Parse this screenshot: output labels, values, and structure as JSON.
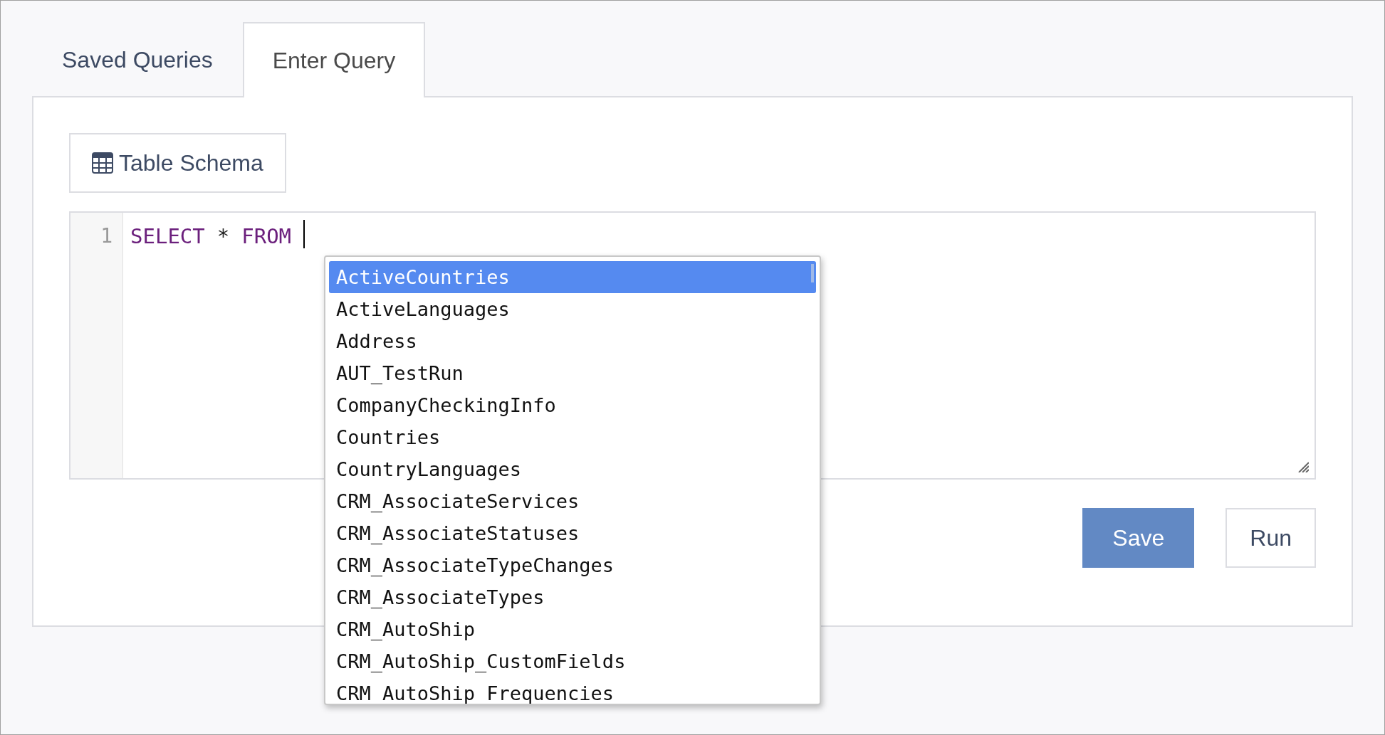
{
  "tabs": [
    {
      "label": "Saved Queries",
      "selected": false
    },
    {
      "label": "Enter Query",
      "selected": true
    }
  ],
  "schema_button": {
    "label": "Table Schema"
  },
  "editor": {
    "line_number": "1",
    "tokens": [
      {
        "text": "SELECT",
        "kind": "keyword"
      },
      {
        "text": "*",
        "kind": "operator"
      },
      {
        "text": "FROM",
        "kind": "keyword"
      }
    ],
    "autocomplete": [
      {
        "label": "ActiveCountries",
        "selected": true
      },
      {
        "label": "ActiveLanguages",
        "selected": false
      },
      {
        "label": "Address",
        "selected": false
      },
      {
        "label": "AUT_TestRun",
        "selected": false
      },
      {
        "label": "CompanyCheckingInfo",
        "selected": false
      },
      {
        "label": "Countries",
        "selected": false
      },
      {
        "label": "CountryLanguages",
        "selected": false
      },
      {
        "label": "CRM_AssociateServices",
        "selected": false
      },
      {
        "label": "CRM_AssociateStatuses",
        "selected": false
      },
      {
        "label": "CRM_AssociateTypeChanges",
        "selected": false
      },
      {
        "label": "CRM_AssociateTypes",
        "selected": false
      },
      {
        "label": "CRM_AutoShip",
        "selected": false
      },
      {
        "label": "CRM_AutoShip_CustomFields",
        "selected": false
      },
      {
        "label": "CRM_AutoShip_Frequencies",
        "selected": false
      }
    ]
  },
  "buttons": [
    {
      "label": "Save",
      "kind": "primary"
    },
    {
      "label": "Run",
      "kind": "secondary"
    }
  ]
}
